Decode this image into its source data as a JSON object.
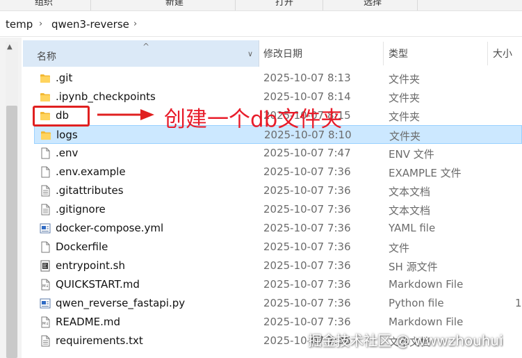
{
  "ribbon": {
    "items": [
      "组织",
      "新建",
      "打开",
      "选择"
    ]
  },
  "breadcrumb": {
    "items": [
      "temp",
      "qwen3-reverse"
    ]
  },
  "columns": {
    "name": "名称",
    "date": "修改日期",
    "type": "类型",
    "size": "大小"
  },
  "files": [
    {
      "name": ".git",
      "date": "2025-10-07 8:13",
      "type": "文件夹",
      "size": "",
      "icon": "folder-icon"
    },
    {
      "name": ".ipynb_checkpoints",
      "date": "2025-10-07 8:14",
      "type": "文件夹",
      "size": "",
      "icon": "folder-icon"
    },
    {
      "name": "db",
      "date": "2025-10-07 8:15",
      "type": "文件夹",
      "size": "",
      "icon": "folder-icon"
    },
    {
      "name": "logs",
      "date": "2025-10-07 8:10",
      "type": "文件夹",
      "size": "",
      "icon": "folder-icon",
      "selected": true
    },
    {
      "name": ".env",
      "date": "2025-10-07 7:47",
      "type": "ENV 文件",
      "size": "",
      "icon": "blank-file-icon"
    },
    {
      "name": ".env.example",
      "date": "2025-10-07 7:36",
      "type": "EXAMPLE 文件",
      "size": "",
      "icon": "blank-file-icon"
    },
    {
      "name": ".gitattributes",
      "date": "2025-10-07 7:36",
      "type": "文本文档",
      "size": "",
      "icon": "text-file-icon"
    },
    {
      "name": ".gitignore",
      "date": "2025-10-07 7:36",
      "type": "文本文档",
      "size": "",
      "icon": "text-file-icon"
    },
    {
      "name": "docker-compose.yml",
      "date": "2025-10-07 7:36",
      "type": "YAML file",
      "size": "",
      "icon": "code-file-icon"
    },
    {
      "name": "Dockerfile",
      "date": "2025-10-07 7:36",
      "type": "文件",
      "size": "",
      "icon": "blank-file-icon"
    },
    {
      "name": "entrypoint.sh",
      "date": "2025-10-07 7:36",
      "type": "SH 源文件",
      "size": "",
      "icon": "script-file-icon"
    },
    {
      "name": "QUICKSTART.md",
      "date": "2025-10-07 7:36",
      "type": "Markdown File",
      "size": "",
      "icon": "markdown-file-icon"
    },
    {
      "name": "qwen_reverse_fastapi.py",
      "date": "2025-10-07 7:36",
      "type": "Python file",
      "size": "1",
      "icon": "code-file-icon"
    },
    {
      "name": "README.md",
      "date": "2025-10-07 7:36",
      "type": "Markdown File",
      "size": "",
      "icon": "markdown-file-icon"
    },
    {
      "name": "requirements.txt",
      "date": "2025-10-07 7:36",
      "type": "文本文档",
      "size": "",
      "icon": "text-file-icon"
    }
  ],
  "annotation": {
    "text": "创建一个db文件夹",
    "color": "#e81c2a"
  },
  "watermark": {
    "text": "掘金技术社区 @ wwwzhouhui"
  },
  "colors": {
    "selection": "#cce8ff",
    "header_active": "#dbe9f7",
    "folder": "#f5c542"
  }
}
